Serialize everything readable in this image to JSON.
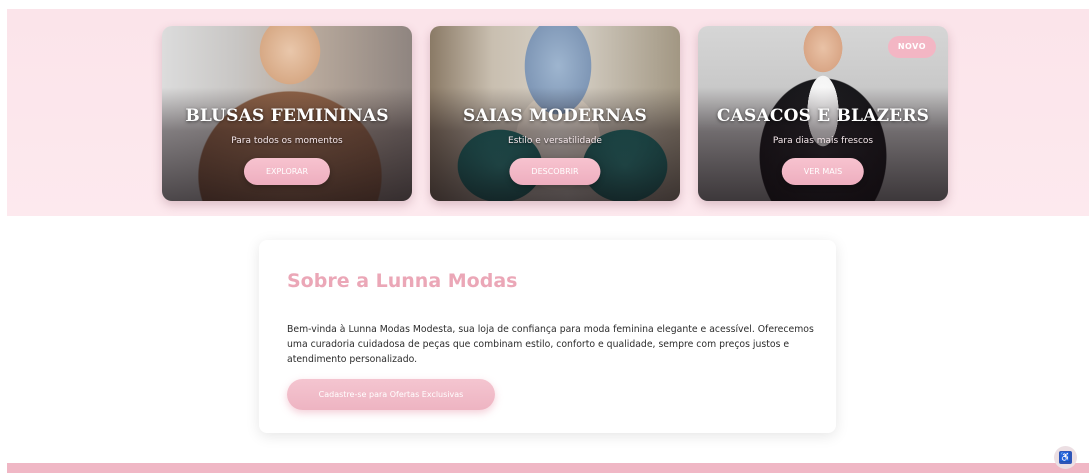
{
  "categories": [
    {
      "title": "BLUSAS FEMININAS",
      "subtitle": "Para todos os momentos",
      "button": "EXPLORAR",
      "badge": ""
    },
    {
      "title": "SAIAS MODERNAS",
      "subtitle": "Estilo e versatilidade",
      "button": "DESCOBRIR",
      "badge": ""
    },
    {
      "title": "CASACOS E BLAZERS",
      "subtitle": "Para dias mais frescos",
      "button": "VER MAIS",
      "badge": "NOVO"
    }
  ],
  "about": {
    "title": "Sobre a Lunna Modas",
    "text": "Bem-vinda à Lunna Modas Modesta, sua loja de confiança para moda feminina elegante e acessível. Oferecemos uma curadoria cuidadosa de peças que combinam estilo, conforto e qualidade, sempre com preços justos e atendimento personalizado.",
    "button": "Cadastre-se para Ofertas Exclusivas"
  },
  "accessibility": {
    "icon": "accessibility-icon",
    "glyph": "♿"
  },
  "colors": {
    "accent_pink": "#eba7b7",
    "button_pink": "#f3b6c4",
    "section_bg": "#fbe4ea",
    "footer_pink": "#f0b7c5"
  }
}
